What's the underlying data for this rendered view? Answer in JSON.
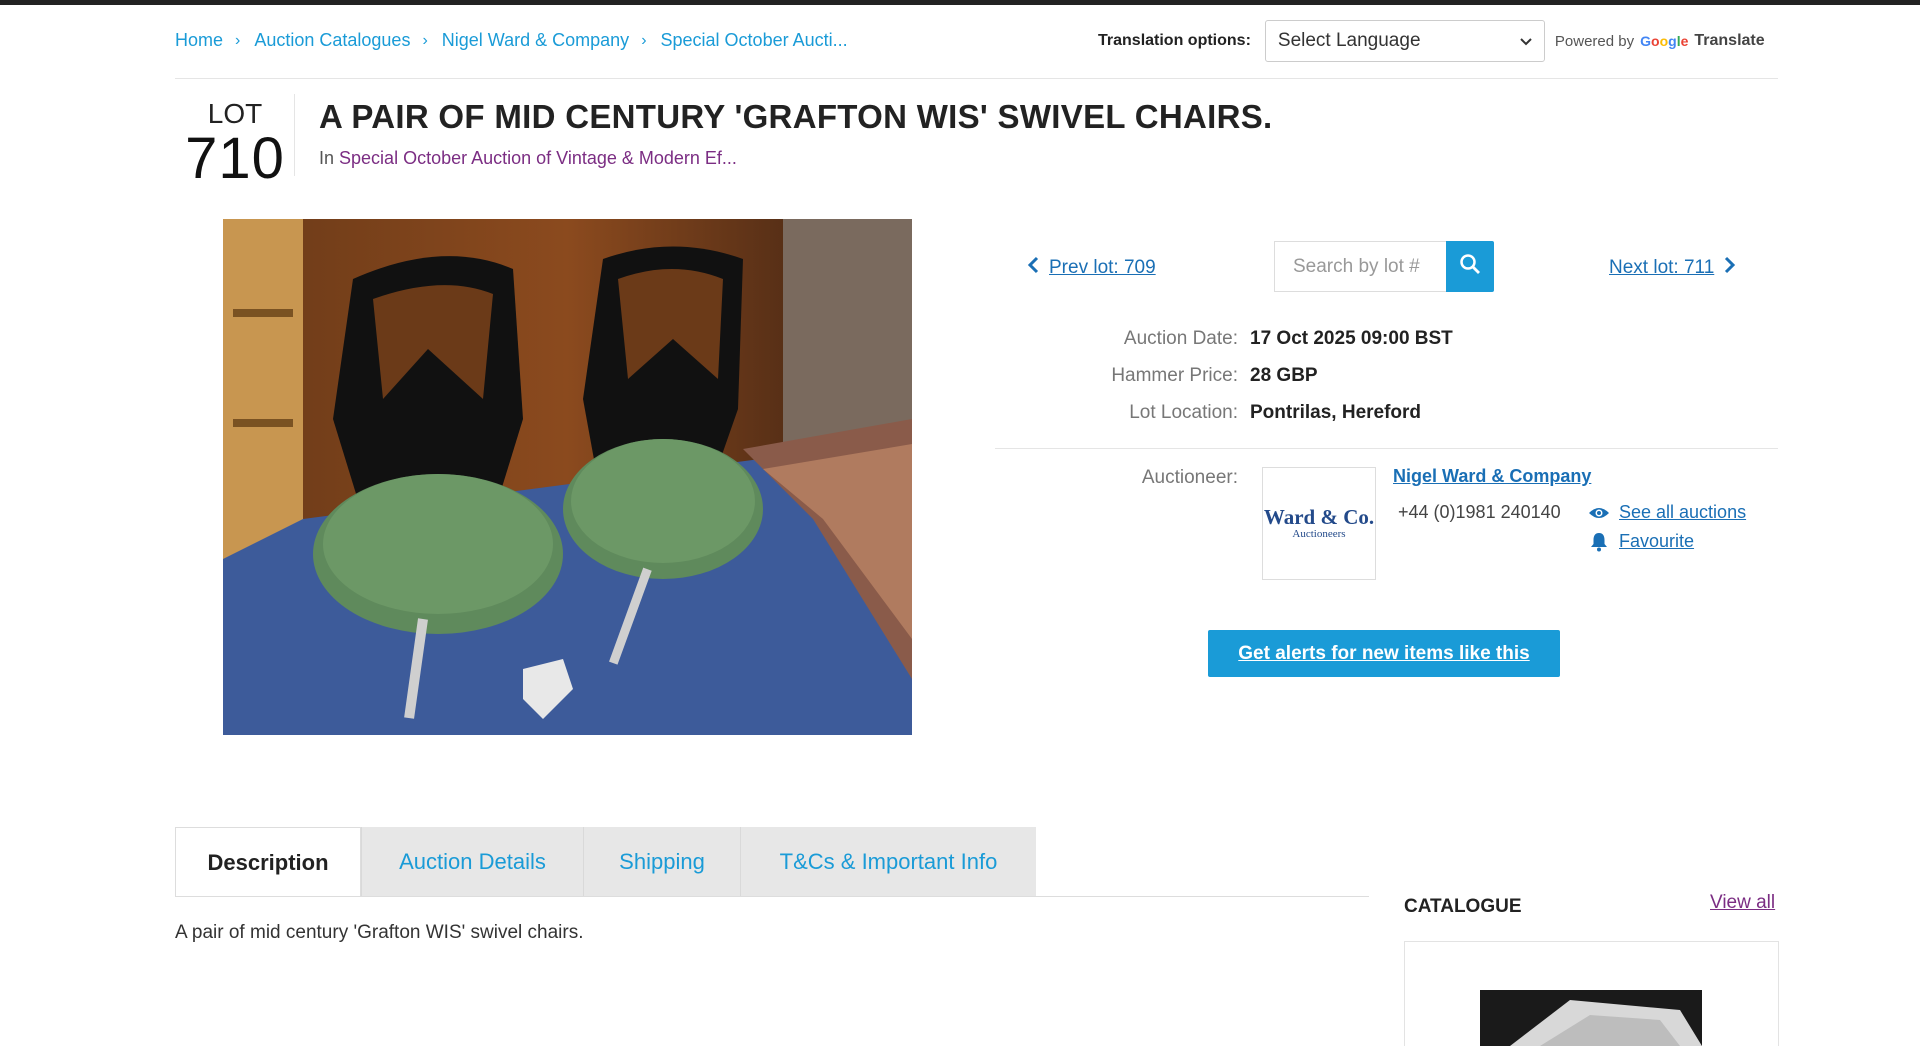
{
  "breadcrumb": {
    "items": [
      "Home",
      "Auction Catalogues",
      "Nigel Ward & Company",
      "Special October Aucti..."
    ],
    "separator": "›"
  },
  "translation": {
    "label": "Translation options:",
    "select_value": "Select Language",
    "powered_by": "Powered by",
    "google": [
      "G",
      "o",
      "o",
      "g",
      "l",
      "e"
    ],
    "translate_word": "Translate"
  },
  "lot": {
    "lot_word": "LOT",
    "number": "710",
    "title": "A PAIR OF MID CENTURY 'GRAFTON WIS' SWIVEL CHAIRS.",
    "in_prefix": "In",
    "auction_link": "Special October Auction of Vintage & Modern Ef..."
  },
  "lot_nav": {
    "prev_label": "Prev lot: 709",
    "next_label": "Next lot: 711",
    "search_placeholder": "Search by lot #"
  },
  "details": [
    {
      "label": "Auction Date:",
      "value": "17 Oct 2025 09:00 BST"
    },
    {
      "label": "Hammer Price:",
      "value": "28 GBP"
    },
    {
      "label": "Lot Location:",
      "value": "Pontrilas, Hereford"
    }
  ],
  "auctioneer": {
    "label": "Auctioneer:",
    "name": "Nigel Ward & Company",
    "phone": "+44 (0)1981 240140",
    "logo_line1": "Ward & Co.",
    "logo_line2": "Auctioneers",
    "see_all": "See all auctions",
    "favourite": "Favourite"
  },
  "alerts_button": "Get alerts for new items like this",
  "tabs": [
    "Description",
    "Auction Details",
    "Shipping",
    "T&Cs & Important Info"
  ],
  "description": "A pair of mid century 'Grafton WIS' swivel chairs.",
  "catalogue": {
    "title": "CATALOGUE",
    "view_all": "View all"
  },
  "colors": {
    "link_blue": "#1a9bd7",
    "nav_blue": "#1a6fb5",
    "purple_link": "#7b2d83",
    "button_blue": "#1a9bd7"
  },
  "icons": [
    "chevron-right-icon",
    "chevron-down-icon",
    "chevron-left-icon",
    "search-icon",
    "eye-icon",
    "bell-icon"
  ]
}
